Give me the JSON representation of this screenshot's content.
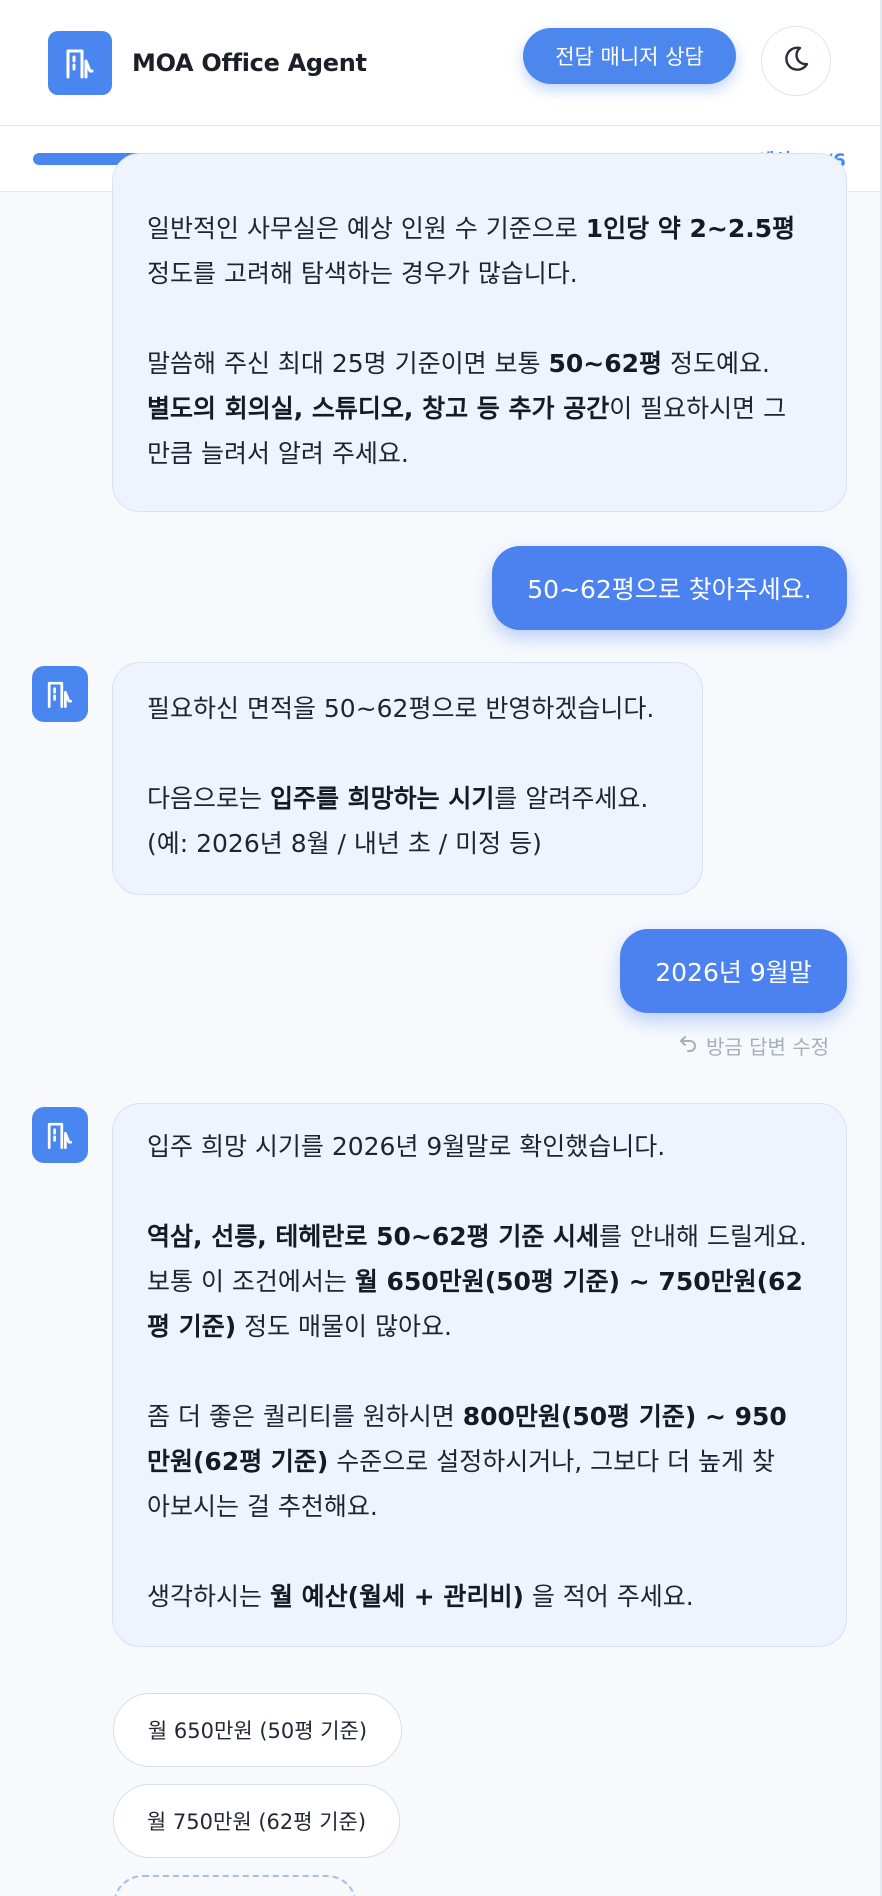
{
  "header": {
    "brand": "MOA Office Agent",
    "consult_button": "전담 매니저 상담",
    "logo_icon": "building-icon",
    "theme_icon": "moon-icon",
    "accent": "#4a86f0"
  },
  "progress": {
    "label": "예산 · 4/6",
    "fraction": 0.64
  },
  "messages": {
    "bot1": {
      "p1_a": "일반적인 사무실은 예상 인원 수 기준으로 ",
      "p1_b": "1인당 약 2~2.5평",
      "p1_c": "정도를 고려해 탐색하는 경우가 많습니다.",
      "p2_a": "말씀해 주신 최대 25명 기준이면 보통 ",
      "p2_b": "50~62평",
      "p2_c": " 정도예요.",
      "p3_a": "별도의 회의실, 스튜디오, 창고 등 추가 공간",
      "p3_b": "이 필요하시면 그",
      "p3_c": "만큼 늘려서 알려 주세요."
    },
    "user1": "50~62평으로 찾아주세요.",
    "bot2": {
      "p1": "필요하신 면적을 50~62평으로 반영하겠습니다.",
      "p2_a": "다음으로는 ",
      "p2_b": "입주를 희망하는 시기",
      "p2_c": "를 알려주세요.",
      "p3": "(예: 2026년 8월 / 내년 초 / 미정 등)"
    },
    "user2": "2026년 9월말",
    "edit_label": "방금 답변 수정",
    "bot3": {
      "p1": "입주 희망 시기를 2026년 9월말로 확인했습니다.",
      "p2_a": "역삼, 선릉, 테헤란로 50~62평 기준 시세",
      "p2_b": "를 안내해 드릴게요.",
      "p3_a": "보통 이 조건에서는 ",
      "p3_b": "월 650만원(50평 기준) ~ 750만원(62",
      "p3_c": "평 기준)",
      "p3_d": " 정도 매물이 많아요.",
      "p4_a": "좀 더 좋은 퀄리티를 원하시면 ",
      "p4_b": "800만원(50평 기준) ~ 950",
      "p4_c": "만원(62평 기준)",
      "p4_d": " 수준으로 설정하시거나, 그보다 더 높게 찾",
      "p4_e": "아보시는 걸 추천해요.",
      "p5_a": "생각하시는 ",
      "p5_b": "월 예산(월세 + 관리비)",
      "p5_c": " 을 적어 주세요."
    }
  },
  "chips": [
    "월 650만원 (50평 기준)",
    "월 750만원 (62평 기준)"
  ]
}
